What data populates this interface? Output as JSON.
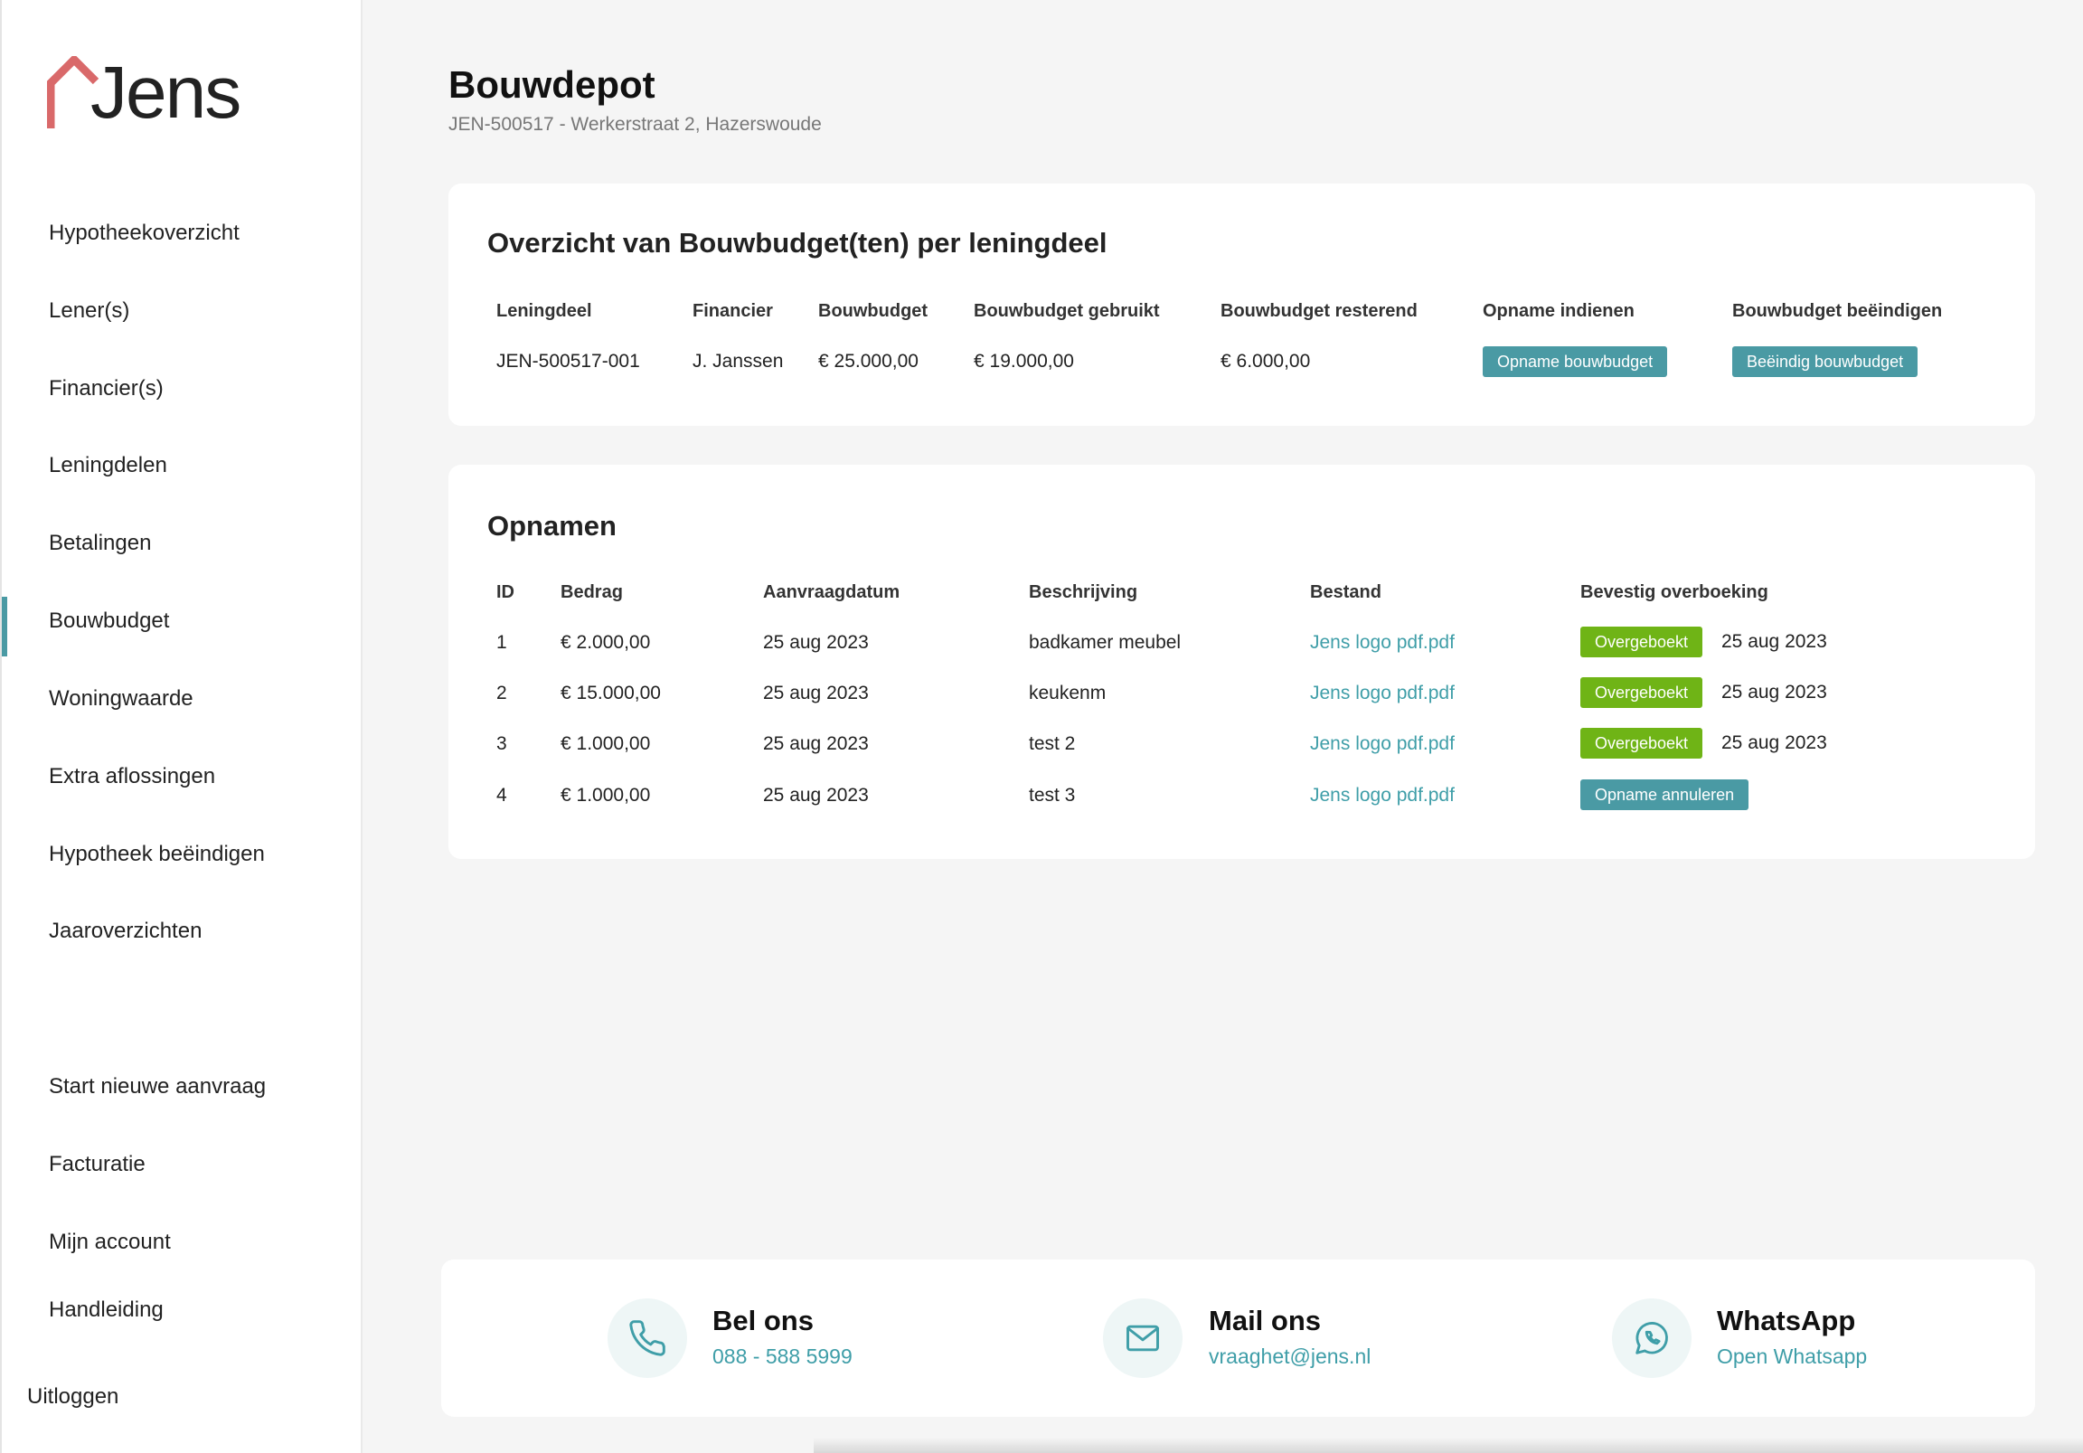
{
  "brand": {
    "name": "Jens",
    "roof_color": "#d9696a"
  },
  "sidebar": {
    "items": [
      {
        "label": "Hypotheekoverzicht"
      },
      {
        "label": "Lener(s)"
      },
      {
        "label": "Financier(s)"
      },
      {
        "label": "Leningdelen"
      },
      {
        "label": "Betalingen"
      },
      {
        "label": "Bouwbudget",
        "active": true
      },
      {
        "label": "Woningwaarde"
      },
      {
        "label": "Extra aflossingen"
      },
      {
        "label": "Hypotheek beëindigen"
      },
      {
        "label": "Jaaroverzichten"
      }
    ],
    "secondary": [
      {
        "label": "Start nieuwe aanvraag"
      },
      {
        "label": "Facturatie"
      },
      {
        "label": "Mijn account"
      },
      {
        "label": "Handleiding"
      }
    ],
    "logout": "Uitloggen"
  },
  "header": {
    "title": "Bouwdepot",
    "subtitle": "JEN-500517 - Werkerstraat 2, Hazerswoude"
  },
  "overview": {
    "title": "Overzicht van Bouwbudget(ten) per leningdeel",
    "columns": [
      "Leningdeel",
      "Financier",
      "Bouwbudget",
      "Bouwbudget gebruikt",
      "Bouwbudget resterend",
      "Opname indienen",
      "Bouwbudget beëindigen"
    ],
    "row": {
      "leningdeel": "JEN-500517-001",
      "financier": "J. Janssen",
      "bouwbudget": "€ 25.000,00",
      "gebruikt": "€ 19.000,00",
      "resterend": "€ 6.000,00",
      "opname_button": "Opname bouwbudget",
      "beeindig_button": "Beëindig bouwbudget"
    }
  },
  "withdrawals": {
    "title": "Opnamen",
    "columns": [
      "ID",
      "Bedrag",
      "Aanvraagdatum",
      "Beschrijving",
      "Bestand",
      "Bevestig overboeking"
    ],
    "rows": [
      {
        "id": "1",
        "bedrag": "€ 2.000,00",
        "datum": "25 aug 2023",
        "beschrijving": "badkamer meubel",
        "bestand": "Jens logo pdf.pdf",
        "status": "Overgeboekt",
        "status_datum": "25 aug 2023"
      },
      {
        "id": "2",
        "bedrag": "€ 15.000,00",
        "datum": "25 aug 2023",
        "beschrijving": "keukenm",
        "bestand": "Jens logo pdf.pdf",
        "status": "Overgeboekt",
        "status_datum": "25 aug 2023"
      },
      {
        "id": "3",
        "bedrag": "€ 1.000,00",
        "datum": "25 aug 2023",
        "beschrijving": "test 2",
        "bestand": "Jens logo pdf.pdf",
        "status": "Overgeboekt",
        "status_datum": "25 aug 2023"
      },
      {
        "id": "4",
        "bedrag": "€ 1.000,00",
        "datum": "25 aug 2023",
        "beschrijving": "test 3",
        "bestand": "Jens logo pdf.pdf",
        "action": "Opname annuleren"
      }
    ]
  },
  "contact": {
    "phone": {
      "title": "Bel ons",
      "value": "088 - 588 5999",
      "icon": "phone-icon"
    },
    "mail": {
      "title": "Mail ons",
      "value": "vraaghet@jens.nl",
      "icon": "mail-icon"
    },
    "whatsapp": {
      "title": "WhatsApp",
      "value": "Open Whatsapp",
      "icon": "whatsapp-icon"
    }
  },
  "colors": {
    "accent": "#4a9aa4",
    "success": "#6fb416",
    "link": "#3f9ea8"
  }
}
